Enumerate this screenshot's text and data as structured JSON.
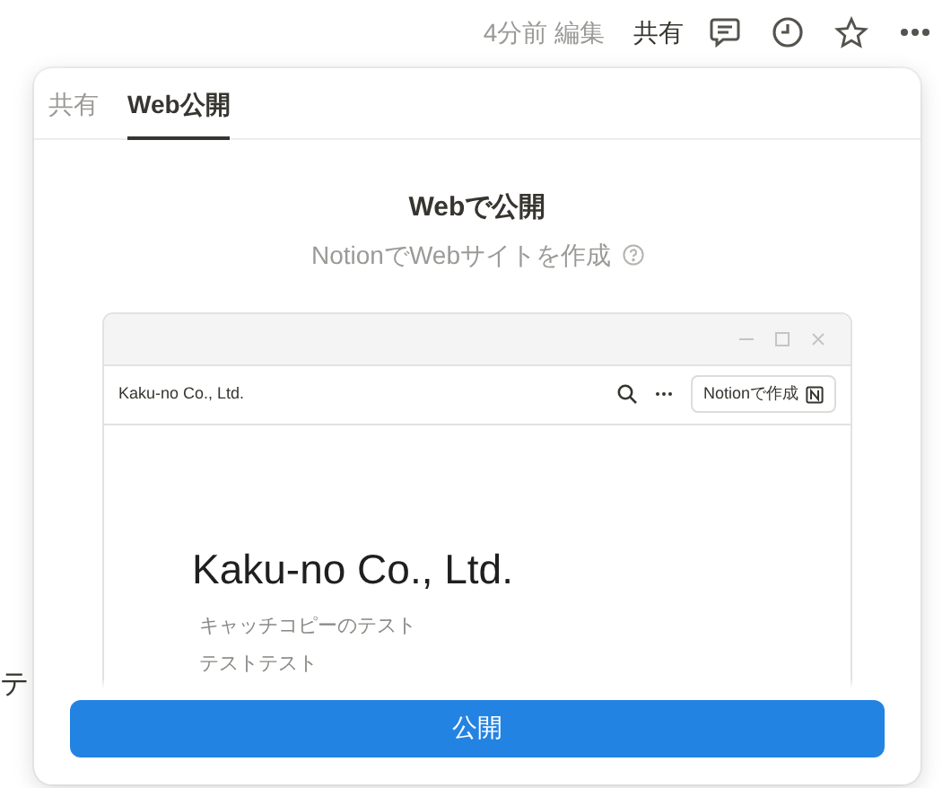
{
  "topbar": {
    "edited": "4分前 編集",
    "share": "共有"
  },
  "background_text": "テ",
  "popup": {
    "tabs": [
      {
        "label": "共有",
        "selected": false
      },
      {
        "label": "Web公開",
        "selected": true
      }
    ],
    "title": "Webで公開",
    "subtitle": "NotionでWebサイトを作成",
    "preview": {
      "site_name": "Kaku-no Co., Ltd.",
      "button": "Notionで作成",
      "heading": "Kaku-no Co., Ltd.",
      "lines": [
        "キャッチコピーのテスト",
        "テストテスト"
      ]
    },
    "publish_button": "公開"
  }
}
